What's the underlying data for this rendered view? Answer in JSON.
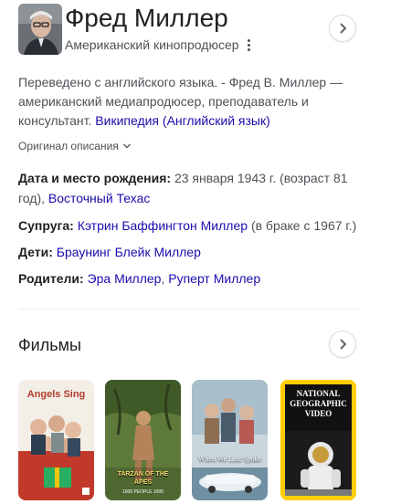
{
  "header": {
    "title": "Фред Миллер",
    "subtitle": "Американский кинопродюсер"
  },
  "description": {
    "text": "Переведено с английского языка. - Фред В. Миллер — американский медиапродюсер, преподаватель и консультант.",
    "source_link": "Википедия (Английский язык)",
    "original_toggle": "Оригинал описания"
  },
  "facts": {
    "birth": {
      "label": "Дата и место рождения:",
      "value": "23 января 1943 г. (возраст 81 год),",
      "link": "Восточный Техас"
    },
    "spouse": {
      "label": "Супруга:",
      "link": "Кэтрин Баффингтон Миллер",
      "note": "(в браке с 1967 г.)"
    },
    "children": {
      "label": "Дети:",
      "link": "Браунинг Блейк Миллер"
    },
    "parents": {
      "label": "Родители:",
      "link1": "Эра Миллер",
      "separator": ",",
      "link2": "Руперт Миллер"
    }
  },
  "films": {
    "heading": "Фильмы",
    "posters": [
      {
        "text": "Angels Sing",
        "icon": "poster-angels-sing"
      },
      {
        "text": "Tarzan of the Apes",
        "small_text": "1000 PEOPLE 1000",
        "icon": "poster-tarzan"
      },
      {
        "text": "When We Last Spoke",
        "icon": "poster-when-we-last-spoke"
      },
      {
        "text": "NATIONAL GEOGRAPHIC VIDEO",
        "icon": "poster-national-geographic"
      }
    ]
  },
  "colors": {
    "link": "#1a0dab",
    "text": "#202124",
    "secondary": "#4d5156",
    "natgeo_yellow": "#ffce00"
  }
}
